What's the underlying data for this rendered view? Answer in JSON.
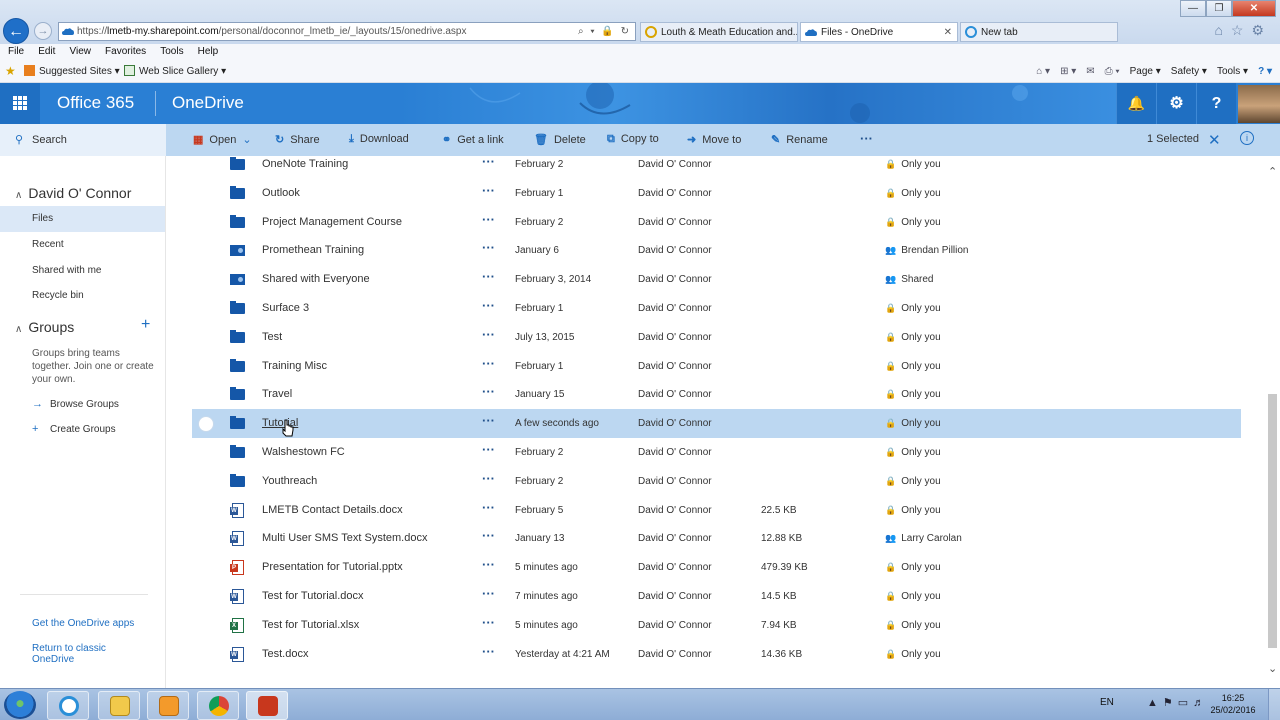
{
  "browser": {
    "url_prefix": "https://",
    "url_host": "lmetb-my.sharepoint.com",
    "url_path": "/personal/doconnor_lmetb_ie/_layouts/15/onedrive.aspx",
    "addr_icons": "⌕ ▾ 🔒 ↻",
    "tabs": [
      {
        "label": "Louth & Meath Education and...",
        "active": false
      },
      {
        "label": "Files - OneDrive",
        "active": true,
        "close": "✕"
      },
      {
        "label": "New tab",
        "active": false
      }
    ],
    "menu": [
      "File",
      "Edit",
      "View",
      "Favorites",
      "Tools",
      "Help"
    ],
    "favorites": {
      "suggested": "Suggested Sites ▾",
      "webslice": "Web Slice Gallery ▾"
    },
    "commands": [
      "Page ▾",
      "Safety ▾",
      "Tools ▾",
      "? ▾"
    ],
    "window_buttons": {
      "min": "—",
      "max": "❐",
      "close": "✕"
    }
  },
  "header": {
    "brand": "Office 365",
    "app": "OneDrive",
    "bell": "🔔",
    "gear": "⚙",
    "help": "?"
  },
  "search": {
    "icon": "⚲",
    "label": "Search"
  },
  "toolbar": {
    "open": "Open",
    "share": "Share",
    "download": "Download",
    "getlink": "Get a link",
    "delete": "Delete",
    "copyto": "Copy to",
    "moveto": "Move to",
    "rename": "Rename",
    "more": "···",
    "selected": "1 Selected",
    "clear": "✕",
    "info": "i"
  },
  "sidebar": {
    "user": "David O' Connor",
    "items": [
      "Files",
      "Recent",
      "Shared with me",
      "Recycle bin"
    ],
    "groups_title": "Groups",
    "groups_text": "Groups bring teams together. Join one or create your own.",
    "browse_groups": "Browse Groups",
    "create_groups": "Create Groups",
    "get_apps": "Get the OneDrive apps",
    "return_classic": "Return to classic OneDrive"
  },
  "files": [
    {
      "name": "OneNote Training",
      "type": "folder",
      "date": "February 2",
      "by": "David O' Connor",
      "size": "",
      "sharing": "Only you",
      "share_icon": "🔒"
    },
    {
      "name": "Outlook",
      "type": "folder",
      "date": "February 1",
      "by": "David O' Connor",
      "size": "",
      "sharing": "Only you",
      "share_icon": "🔒"
    },
    {
      "name": "Project Management Course",
      "type": "folder",
      "date": "February 2",
      "by": "David O' Connor",
      "size": "",
      "sharing": "Only you",
      "share_icon": "🔒"
    },
    {
      "name": "Promethean Training",
      "type": "shared-folder",
      "date": "January 6",
      "by": "David O' Connor",
      "size": "",
      "sharing": "Brendan Pillion",
      "share_icon": "👥"
    },
    {
      "name": "Shared with Everyone",
      "type": "shared-folder",
      "date": "February 3, 2014",
      "by": "David O' Connor",
      "size": "",
      "sharing": "Shared",
      "share_icon": "👥"
    },
    {
      "name": "Surface 3",
      "type": "folder",
      "date": "February 1",
      "by": "David O' Connor",
      "size": "",
      "sharing": "Only you",
      "share_icon": "🔒"
    },
    {
      "name": "Test",
      "type": "folder",
      "date": "July 13, 2015",
      "by": "David O' Connor",
      "size": "",
      "sharing": "Only you",
      "share_icon": "🔒"
    },
    {
      "name": "Training Misc",
      "type": "folder",
      "date": "February 1",
      "by": "David O' Connor",
      "size": "",
      "sharing": "Only you",
      "share_icon": "🔒"
    },
    {
      "name": "Travel",
      "type": "folder",
      "date": "January 15",
      "by": "David O' Connor",
      "size": "",
      "sharing": "Only you",
      "share_icon": "🔒"
    },
    {
      "name": "Tutorial",
      "type": "folder",
      "date": "A few seconds ago",
      "by": "David O' Connor",
      "size": "",
      "sharing": "Only you",
      "share_icon": "🔒",
      "selected": true
    },
    {
      "name": "Walshestown FC",
      "type": "folder",
      "date": "February 2",
      "by": "David O' Connor",
      "size": "",
      "sharing": "Only you",
      "share_icon": "🔒"
    },
    {
      "name": "Youthreach",
      "type": "folder",
      "date": "February 2",
      "by": "David O' Connor",
      "size": "",
      "sharing": "Only you",
      "share_icon": "🔒"
    },
    {
      "name": "LMETB Contact Details.docx",
      "type": "doc",
      "date": "February 5",
      "by": "David O' Connor",
      "size": "22.5 KB",
      "sharing": "Only you",
      "share_icon": "🔒"
    },
    {
      "name": "Multi User SMS Text System.docx",
      "type": "doc",
      "date": "January 13",
      "by": "David O' Connor",
      "size": "12.88 KB",
      "sharing": "Larry Carolan",
      "share_icon": "👥"
    },
    {
      "name": "Presentation for Tutorial.pptx",
      "type": "ppt",
      "date": "5 minutes ago",
      "by": "David O' Connor",
      "size": "479.39 KB",
      "sharing": "Only you",
      "share_icon": "🔒"
    },
    {
      "name": "Test for Tutorial.docx",
      "type": "doc",
      "date": "7 minutes ago",
      "by": "David O' Connor",
      "size": "14.5 KB",
      "sharing": "Only you",
      "share_icon": "🔒"
    },
    {
      "name": "Test for Tutorial.xlsx",
      "type": "xls",
      "date": "5 minutes ago",
      "by": "David O' Connor",
      "size": "7.94 KB",
      "sharing": "Only you",
      "share_icon": "🔒"
    },
    {
      "name": "Test.docx",
      "type": "doc",
      "date": "Yesterday at 4:21 AM",
      "by": "David O' Connor",
      "size": "14.36 KB",
      "sharing": "Only you",
      "share_icon": "🔒"
    }
  ],
  "taskbar": {
    "lang": "EN",
    "time": "16:25",
    "date": "25/02/2016"
  },
  "colors": {
    "accent": "#2a7fd4",
    "selection": "#bcd7f1",
    "folder": "#1557a8"
  }
}
